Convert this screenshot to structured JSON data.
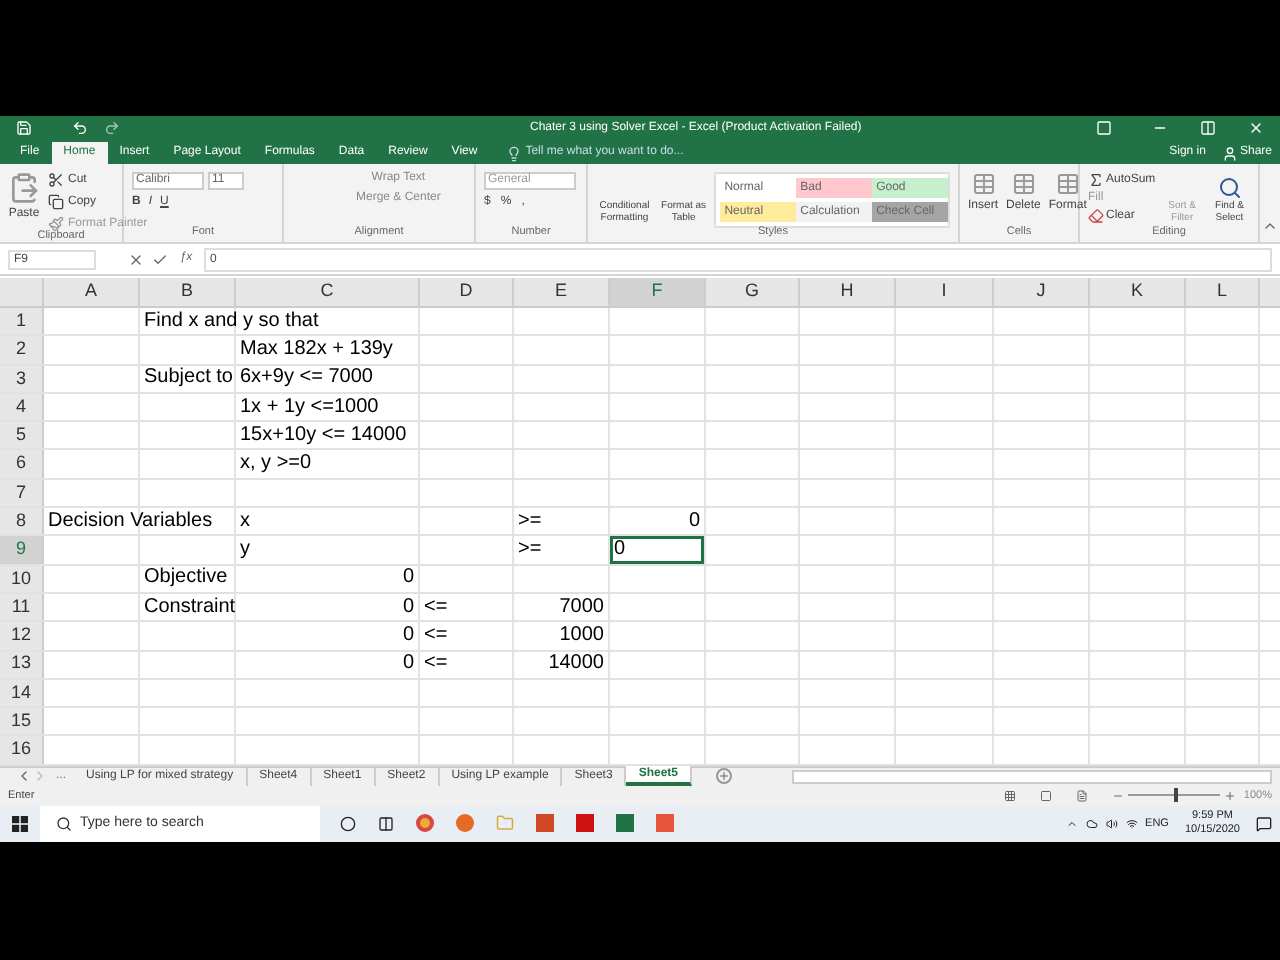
{
  "window": {
    "title": "Chater 3 using Solver Excel - Excel (Product Activation Failed)"
  },
  "tabs": [
    {
      "label": "File",
      "selected": false
    },
    {
      "label": "Home",
      "selected": true
    },
    {
      "label": "Insert",
      "selected": false
    },
    {
      "label": "Page Layout",
      "selected": false
    },
    {
      "label": "Formulas",
      "selected": false
    },
    {
      "label": "Data",
      "selected": false
    },
    {
      "label": "Review",
      "selected": false
    },
    {
      "label": "View",
      "selected": false
    }
  ],
  "tell_me": {
    "placeholder": "Tell me what you want to do..."
  },
  "account": {
    "sign_in": "Sign in",
    "share": "Share"
  },
  "ribbon": {
    "groups": [
      {
        "kind": "clipboard",
        "label": "Clipboard",
        "controls": [
          "Paste",
          "Cut",
          "Copy",
          "Format Painter"
        ]
      },
      {
        "kind": "font",
        "label": "Font",
        "font_name": "Calibri",
        "font_size": "11",
        "controls": [
          "B",
          "I",
          "U"
        ]
      },
      {
        "kind": "alignment",
        "label": "Alignment",
        "controls": [
          "Wrap Text",
          "Merge & Center"
        ]
      },
      {
        "kind": "number",
        "label": "Number",
        "format": "General",
        "controls": [
          "$",
          "%",
          ","
        ]
      },
      {
        "kind": "styles",
        "label": "Styles",
        "controls": [
          "Conditional Formatting",
          "Format as Table"
        ],
        "styles": [
          {
            "label": "Normal",
            "color": "#ffffff"
          },
          {
            "label": "Bad",
            "color": "#ffc7ce"
          },
          {
            "label": "Good",
            "color": "#c6efce"
          },
          {
            "label": "Neutral",
            "color": "#ffeb9c"
          },
          {
            "label": "Calculation",
            "color": "#f2f2f2"
          },
          {
            "label": "Check Cell",
            "color": "#a5a5a5"
          }
        ]
      },
      {
        "kind": "cells",
        "label": "Cells",
        "controls": [
          "Insert",
          "Delete",
          "Format"
        ]
      },
      {
        "kind": "editing",
        "label": "Editing",
        "controls": [
          "AutoSum",
          "Fill",
          "Clear",
          "Sort & Filter",
          "Find & Select"
        ]
      }
    ]
  },
  "formula_bar": {
    "name_box": "F9",
    "function_label": "ƒx",
    "value": "0"
  },
  "columns": [
    {
      "label": "A",
      "selected": false
    },
    {
      "label": "B",
      "selected": false
    },
    {
      "label": "C",
      "selected": false
    },
    {
      "label": "D",
      "selected": false
    },
    {
      "label": "E",
      "selected": false
    },
    {
      "label": "F",
      "selected": true
    },
    {
      "label": "G",
      "selected": false
    },
    {
      "label": "H",
      "selected": false
    },
    {
      "label": "I",
      "selected": false
    },
    {
      "label": "J",
      "selected": false
    },
    {
      "label": "K",
      "selected": false
    },
    {
      "label": "L",
      "selected": false
    }
  ],
  "rows": [
    {
      "label": "1",
      "selected": false,
      "cells": [
        {},
        {
          "text": "Find x and y so that",
          "right_aligned": false
        }
      ]
    },
    {
      "label": "2",
      "selected": false,
      "cells": [
        {},
        {},
        {
          "text": "Max 182x + 139y",
          "right_aligned": false
        }
      ]
    },
    {
      "label": "3",
      "selected": false,
      "cells": [
        {},
        {
          "text": "Subject to",
          "right_aligned": false
        },
        {
          "text": "6x+9y <= 7000",
          "right_aligned": false
        }
      ]
    },
    {
      "label": "4",
      "selected": false,
      "cells": [
        {},
        {},
        {
          "text": "1x + 1y <=1000",
          "right_aligned": false
        }
      ]
    },
    {
      "label": "5",
      "selected": false,
      "cells": [
        {},
        {},
        {
          "text": "15x+10y <= 14000",
          "right_aligned": false
        }
      ]
    },
    {
      "label": "6",
      "selected": false,
      "cells": [
        {},
        {},
        {
          "text": "x, y >=0",
          "right_aligned": false
        }
      ]
    },
    {
      "label": "7",
      "selected": false
    },
    {
      "label": "8",
      "selected": false,
      "cells": [
        {
          "text": "Decision Variables",
          "right_aligned": false
        },
        {},
        {
          "text": "x",
          "right_aligned": false
        },
        {},
        {
          "text": ">=",
          "right_aligned": false
        },
        {
          "text": "0",
          "right_aligned": true
        }
      ]
    },
    {
      "label": "9",
      "selected": true,
      "cells": [
        {},
        {},
        {
          "text": "y",
          "right_aligned": false
        },
        {},
        {
          "text": ">=",
          "right_aligned": false
        },
        {
          "text": "0",
          "right_aligned": false
        }
      ]
    },
    {
      "label": "10",
      "selected": false,
      "cells": [
        {},
        {
          "text": "Objective",
          "right_aligned": false
        },
        {
          "text": "0",
          "right_aligned": true
        }
      ]
    },
    {
      "label": "11",
      "selected": false,
      "cells": [
        {},
        {
          "text": "Constraint",
          "right_aligned": false
        },
        {
          "text": "0",
          "right_aligned": true
        },
        {
          "text": "<=",
          "right_aligned": false
        },
        {
          "text": "7000",
          "right_aligned": true
        }
      ]
    },
    {
      "label": "12",
      "selected": false,
      "cells": [
        {},
        {},
        {
          "text": "0",
          "right_aligned": true
        },
        {
          "text": "<=",
          "right_aligned": false
        },
        {
          "text": "1000",
          "right_aligned": true
        }
      ]
    },
    {
      "label": "13",
      "selected": false,
      "cells": [
        {},
        {},
        {
          "text": "0",
          "right_aligned": true
        },
        {
          "text": "<=",
          "right_aligned": false
        },
        {
          "text": "14000",
          "right_aligned": true
        }
      ]
    },
    {
      "label": "14",
      "selected": false
    },
    {
      "label": "15",
      "selected": false
    },
    {
      "label": "16",
      "selected": false
    }
  ],
  "sheet_tabs": [
    {
      "label": "Using LP for mixed strategy",
      "selected": false
    },
    {
      "label": "Sheet4",
      "selected": false
    },
    {
      "label": "Sheet1",
      "selected": false
    },
    {
      "label": "Sheet2",
      "selected": false
    },
    {
      "label": "Using LP example",
      "selected": false
    },
    {
      "label": "Sheet3",
      "selected": false
    },
    {
      "label": "Sheet5",
      "selected": true
    }
  ],
  "sheet_nav": {
    "more": "..."
  },
  "status_bar": {
    "mode": "Enter",
    "zoom": {
      "level": 0.5,
      "reading": "100%"
    }
  },
  "taskbar": {
    "search": {
      "placeholder": "Type here to search"
    },
    "language": "ENG",
    "time": "9:59 PM",
    "date": "10/15/2020"
  }
}
